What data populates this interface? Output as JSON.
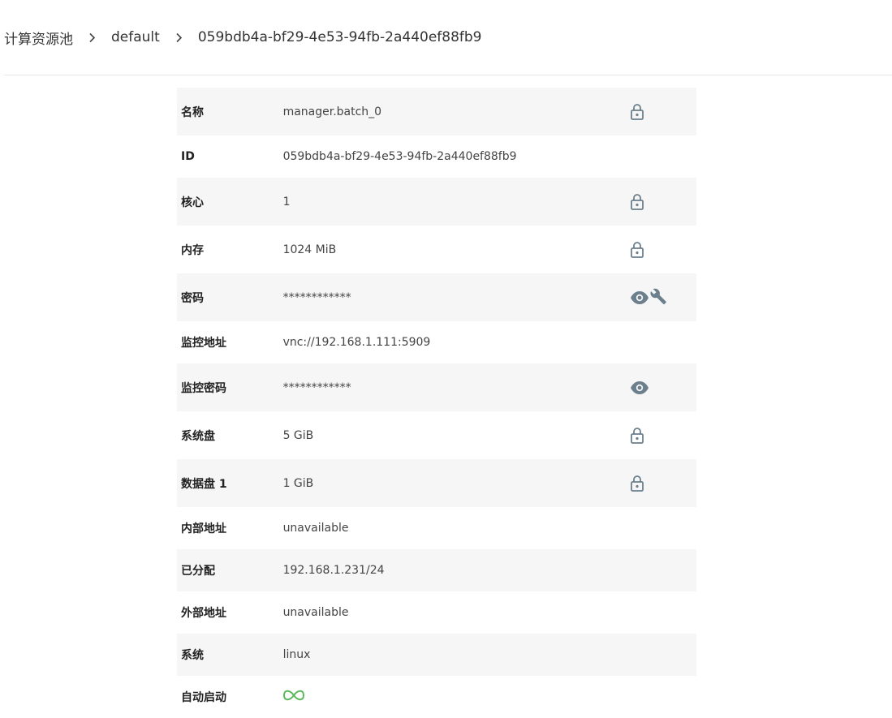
{
  "breadcrumb": {
    "items": [
      "计算资源池",
      "default",
      "059bdb4a-bf29-4e53-94fb-2a440ef88fb9"
    ]
  },
  "colors": {
    "icon": "#6b7f8c",
    "autostart": "#5cb85c",
    "row_shaded": "#f6f6f6"
  },
  "details": {
    "name": {
      "label": "名称",
      "value": "manager.batch_0",
      "icons": [
        "lock-icon"
      ]
    },
    "id": {
      "label": "ID",
      "value": "059bdb4a-bf29-4e53-94fb-2a440ef88fb9",
      "icons": []
    },
    "cores": {
      "label": "核心",
      "value": "1",
      "icons": [
        "lock-icon"
      ]
    },
    "memory": {
      "label": "内存",
      "value": "1024 MiB",
      "icons": [
        "lock-icon"
      ]
    },
    "password": {
      "label": "密码",
      "value": "************",
      "icons": [
        "eye-icon",
        "wrench-icon"
      ]
    },
    "monitor_address": {
      "label": "监控地址",
      "value": "vnc://192.168.1.111:5909",
      "icons": []
    },
    "monitor_password": {
      "label": "监控密码",
      "value": "************",
      "icons": [
        "eye-icon"
      ]
    },
    "system_disk": {
      "label": "系统盘",
      "value": "5 GiB",
      "icons": [
        "lock-icon"
      ]
    },
    "data_disk_1": {
      "label": "数据盘 1",
      "value": "1 GiB",
      "icons": [
        "lock-icon"
      ]
    },
    "internal_address": {
      "label": "内部地址",
      "value": "unavailable",
      "icons": []
    },
    "allocated": {
      "label": "已分配",
      "value": "192.168.1.231/24",
      "icons": []
    },
    "external_address": {
      "label": "外部地址",
      "value": "unavailable",
      "icons": []
    },
    "os": {
      "label": "系统",
      "value": "linux",
      "icons": []
    },
    "autostart": {
      "label": "自动启动",
      "value": "",
      "icons": [
        "infinity-icon"
      ]
    }
  }
}
